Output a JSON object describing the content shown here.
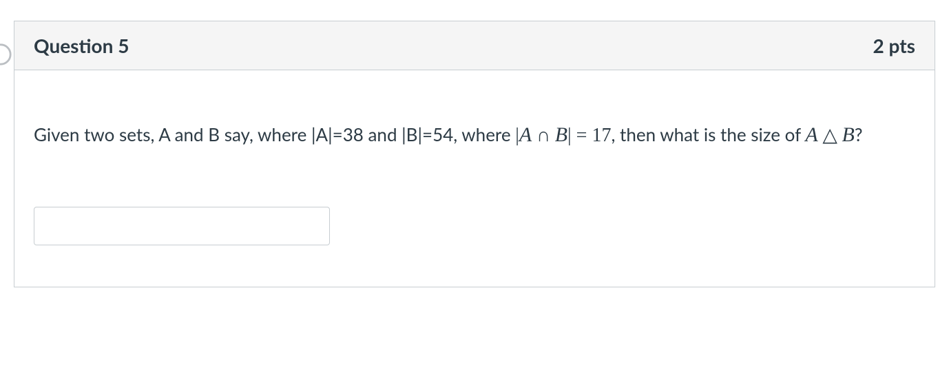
{
  "question": {
    "title": "Question 5",
    "points": "2 pts",
    "text_pre": "Given two sets, A and B say, where |A|=38 and |B|=54, where ",
    "math1_A": "A",
    "math1_cap": "∩",
    "math1_B": "B",
    "math1_bars_left": "|",
    "math1_bars_right": "|",
    "math1_eq": " = 17",
    "text_mid": ", then what is the size of ",
    "math2_A": "A",
    "math2_tri": "△",
    "math2_B": "B",
    "text_post": "?"
  },
  "answer": {
    "value": ""
  }
}
